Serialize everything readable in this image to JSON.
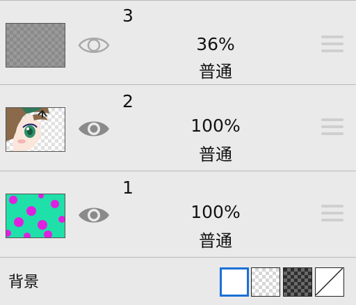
{
  "layers": [
    {
      "number": "3",
      "opacity": "36%",
      "blend_mode": "普通",
      "visible": false
    },
    {
      "number": "2",
      "opacity": "100%",
      "blend_mode": "普通",
      "visible": true
    },
    {
      "number": "1",
      "opacity": "100%",
      "blend_mode": "普通",
      "visible": true
    }
  ],
  "background": {
    "label": "背景",
    "selected": "white",
    "options": [
      "white",
      "light-checker",
      "dark-checker",
      "none"
    ]
  },
  "colors": {
    "selection_accent": "#1a6fd6",
    "layer1_fill": "#1fe0a8",
    "layer1_dots": "#e020e0",
    "eye_visible": "#8a8a8a",
    "eye_hidden": "#a8a8a8"
  }
}
